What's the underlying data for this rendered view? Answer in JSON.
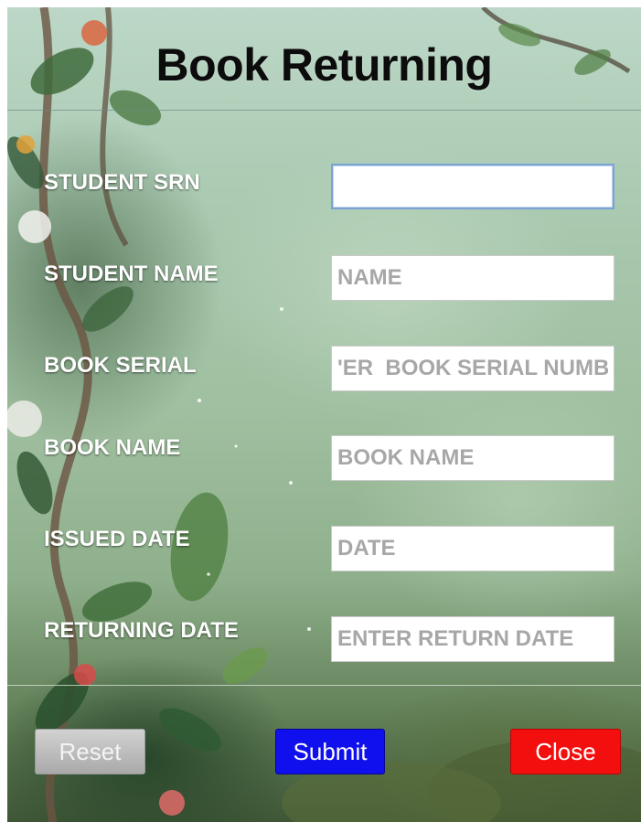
{
  "form": {
    "title": "Book Returning",
    "fields": [
      {
        "label": "STUDENT SRN",
        "value": "",
        "placeholder": ""
      },
      {
        "label": "STUDENT NAME",
        "value": "",
        "placeholder": "NAME"
      },
      {
        "label": "BOOK SERIAL",
        "value": "",
        "placeholder": "'ER  BOOK SERIAL NUMBER"
      },
      {
        "label": "BOOK NAME",
        "value": "",
        "placeholder": "BOOK NAME"
      },
      {
        "label": "ISSUED DATE",
        "value": "",
        "placeholder": "DATE"
      },
      {
        "label": "RETURNING DATE",
        "value": "",
        "placeholder": "ENTER RETURN DATE"
      }
    ]
  },
  "buttons": {
    "reset": "Reset",
    "submit": "Submit",
    "close": "Close"
  },
  "colors": {
    "submit": "#1010ee",
    "close": "#f40f0f",
    "reset": "#bdbdbd",
    "active_border": "#7ba3d4"
  }
}
